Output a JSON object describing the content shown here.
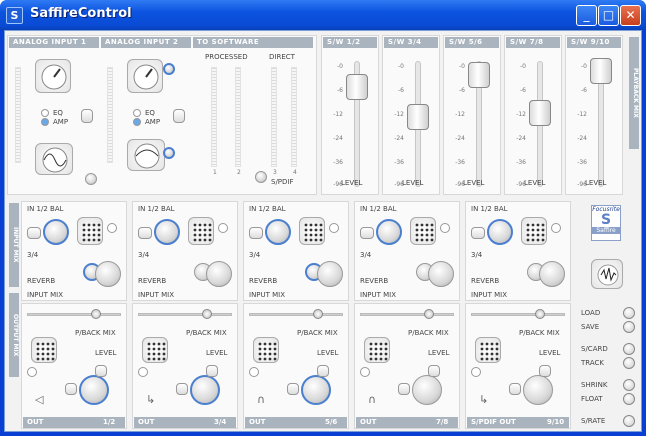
{
  "window": {
    "title": "SaffireControl",
    "icon": "S",
    "min": "_",
    "max": "□",
    "close": "✕"
  },
  "analog": {
    "input1": "ANALOG INPUT 1",
    "input2": "ANALOG INPUT 2",
    "to_software": "TO SOFTWARE",
    "eq": "EQ",
    "amp": "AMP",
    "processed": "PROCESSED",
    "direct": "DIRECT",
    "ch1": "1",
    "ch2": "2",
    "ch3": "3",
    "ch4": "4",
    "spdif": "S/PDIF"
  },
  "sw_headers": [
    "S/W 1/2",
    "S/W 3/4",
    "S/W 5/6",
    "S/W 7/8",
    "S/W 9/10"
  ],
  "fader_scale": [
    "-0",
    "-6",
    "-12",
    "-24",
    "-36",
    "-96"
  ],
  "fader_label": "LEVEL",
  "fader_levels_db": [
    -6,
    -15,
    -3,
    -13,
    -2
  ],
  "playback_mix": "PLAYBACK MIX",
  "input_mix": "INPUT MIX",
  "output_mix": "OUTPUT MIX",
  "strips": [
    {
      "in": "IN 1/2 BAL",
      "sub": "3/4",
      "reverb": "REVERB",
      "imix": "INPUT MIX",
      "pmix": "P/BACK MIX",
      "level": "LEVEL",
      "out": "OUT",
      "outnum": "1/2"
    },
    {
      "in": "IN 1/2 BAL",
      "sub": "3/4",
      "reverb": "REVERB",
      "imix": "INPUT MIX",
      "pmix": "P/BACK MIX",
      "level": "LEVEL",
      "out": "OUT",
      "outnum": "3/4"
    },
    {
      "in": "IN 1/2 BAL",
      "sub": "3/4",
      "reverb": "REVERB",
      "imix": "INPUT MIX",
      "pmix": "P/BACK MIX",
      "level": "LEVEL",
      "out": "OUT",
      "outnum": "5/6"
    },
    {
      "in": "IN 1/2 BAL",
      "sub": "3/4",
      "reverb": "REVERB",
      "imix": "INPUT MIX",
      "pmix": "P/BACK MIX",
      "level": "LEVEL",
      "out": "OUT",
      "outnum": "7/8"
    },
    {
      "in": "IN 1/2 BAL",
      "sub": "3/4",
      "reverb": "REVERB",
      "imix": "INPUT MIX",
      "pmix": "P/BACK MIX",
      "level": "LEVEL",
      "out": "S/PDIF OUT",
      "outnum": "9/10"
    }
  ],
  "logo": {
    "top": "Focusrite",
    "mid": "S",
    "bottom": "Saffire"
  },
  "side": {
    "load": "LOAD",
    "save": "SAVE",
    "scard": "S/CARD",
    "track": "TRACK",
    "shrink": "SHRINK",
    "float": "FLOAT",
    "srate": "S/RATE"
  },
  "icons": [
    "saffire-app-icon",
    "mute-speaker-icon",
    "headphones-icon",
    "spdif-arrow-icon",
    "knob-icon",
    "waveform-icon"
  ]
}
